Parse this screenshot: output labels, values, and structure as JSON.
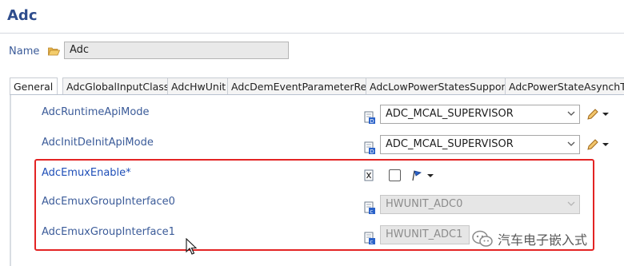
{
  "header": {
    "title": "Adc"
  },
  "name_field": {
    "label": "Name",
    "value": "Adc",
    "icon": "folder-icon"
  },
  "tabs": [
    {
      "label": "General",
      "active": true
    },
    {
      "label": "AdcGlobalInputClass",
      "active": false
    },
    {
      "label": "AdcHwUnit",
      "active": false
    },
    {
      "label": "AdcDemEventParameterRefs",
      "active": false
    },
    {
      "label": "AdcLowPowerStatesSupport",
      "active": false
    },
    {
      "label": "AdcPowerStateAsynchTra",
      "active": false
    }
  ],
  "rows": [
    {
      "label": "AdcRuntimeApiMode",
      "type": "enum",
      "value": "ADC_MCAL_SUPERVISOR",
      "enabled": true
    },
    {
      "label": "AdcInitDeInitApiMode",
      "type": "enum",
      "value": "ADC_MCAL_SUPERVISOR",
      "enabled": true
    },
    {
      "label": "AdcEmuxEnable*",
      "type": "boolean",
      "checked": false
    },
    {
      "label": "AdcEmuxGroupInterface0",
      "type": "reference",
      "value": "HWUNIT_ADC0",
      "enabled": false
    },
    {
      "label": "AdcEmuxGroupInterface1",
      "type": "reference",
      "value": "HWUNIT_ADC1",
      "enabled": false
    }
  ],
  "watermark": {
    "text": "汽车电子嵌入式"
  },
  "colors": {
    "title": "#2f4d8d",
    "label": "#3b5b99",
    "highlight": "#e32424"
  }
}
